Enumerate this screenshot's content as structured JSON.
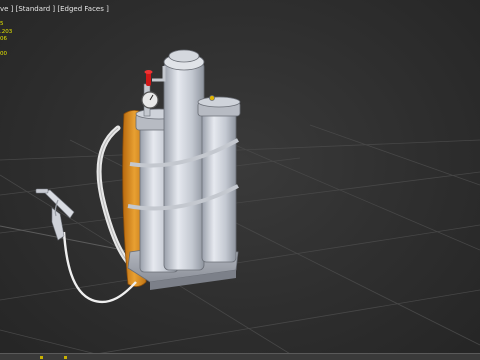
{
  "viewport": {
    "label": "ve ] [Standard ] [Edged Faces ]"
  },
  "stats": {
    "lines": [
      "5",
      ".203",
      "06",
      "",
      "00"
    ]
  },
  "colors": {
    "background": "#2e2e2e",
    "grid": "#4a4a4a",
    "tank": "#c8ccd4",
    "strap": "#d98c1c",
    "valve": "#d01818",
    "stats_text": "#e6e600"
  }
}
